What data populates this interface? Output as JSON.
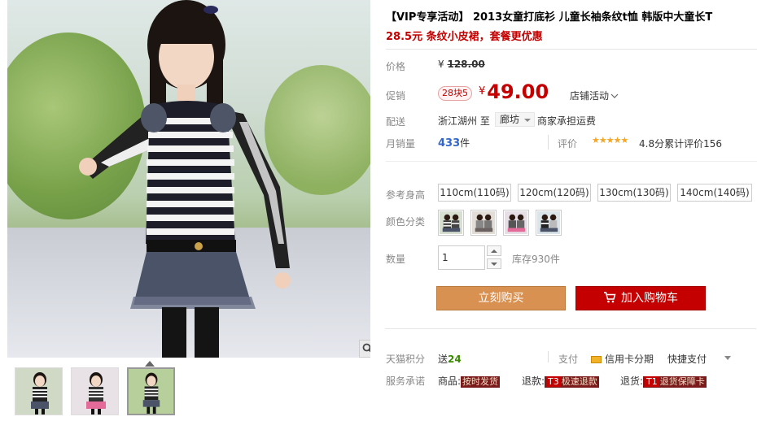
{
  "product": {
    "title": "【VIP专享活动】 2013女童打底衫 儿童长袖条纹t恤 韩版中大童长T",
    "subtitle": "28.5元 条纹小皮裙，套餐更优惠"
  },
  "pricing": {
    "original_label": "价格",
    "original_currency": "¥",
    "original_value": "128.00",
    "promo_label": "促销",
    "promo_tag": "28块5",
    "currency": "¥",
    "promo_value": "49.00",
    "shop_activity": "店铺活动"
  },
  "shipping": {
    "label": "配送",
    "from": "浙江湖州",
    "to_word": "至",
    "city": "廊坊",
    "freight": "商家承担运费"
  },
  "sales": {
    "label": "月销量",
    "count": "433",
    "unit": "件",
    "rating_label": "评价",
    "stars": "★★★★★",
    "rating_value": 4.8,
    "score_text": "4.8分累计评价156"
  },
  "size": {
    "label": "参考身高",
    "options": [
      "110cm(110码)",
      "120cm(120码)",
      "130cm(130码)",
      "140cm(140码)"
    ]
  },
  "color": {
    "label": "颜色分类",
    "options": [
      "style-1",
      "style-2",
      "style-3",
      "style-4"
    ]
  },
  "quantity": {
    "label": "数量",
    "value": "1",
    "stock": "库存930件"
  },
  "actions": {
    "buy_now": "立刻购买",
    "add_cart": "加入购物车"
  },
  "points": {
    "label": "天猫积分",
    "prefix": "送",
    "value": "24"
  },
  "payment": {
    "label": "支付",
    "credit": "信用卡分期",
    "quick": "快捷支付"
  },
  "services": {
    "label": "服务承诺",
    "goods_label": "商品:",
    "goods_tag": "按时发货",
    "refund_label": "退款:",
    "refund_mark": "T3",
    "refund_tag": "极速退款",
    "return_label": "退货:",
    "return_mark": "T1",
    "return_tag": "退货保障卡"
  },
  "icons": {
    "zoom": "magnifier-icon",
    "cart": "cart-icon",
    "card": "credit-card-icon"
  },
  "colors": {
    "accent_red": "#c40000",
    "buy_orange": "#d99152",
    "link_blue": "#3366cc"
  }
}
